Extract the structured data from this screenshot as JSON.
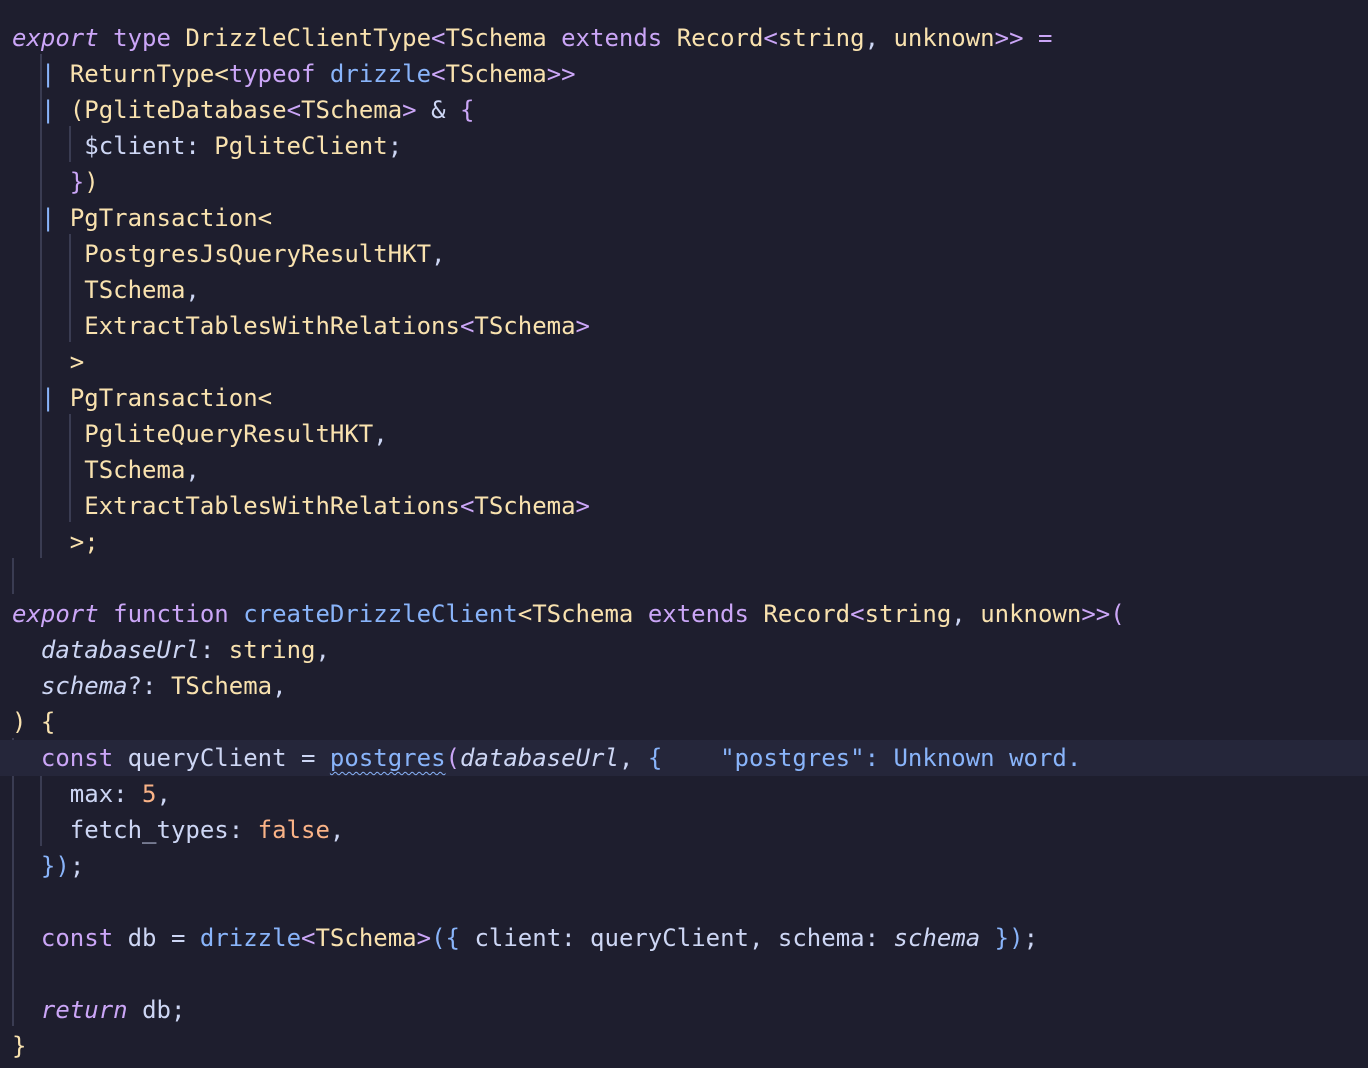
{
  "editor": {
    "language": "typescript",
    "theme_colors": {
      "background": "#1e1e2e",
      "keyword": "#cba6f7",
      "type": "#f9e2af",
      "function": "#89b4fa",
      "text": "#cdd6f4",
      "number": "#fab387",
      "current_line": "#25263a"
    },
    "diagnostic": {
      "word": "\"postgres\"",
      "message": ": Unknown word."
    },
    "tokens": {
      "export": "export",
      "type": "type",
      "DrizzleClientType": "DrizzleClientType",
      "lt": "<",
      "gt": ">",
      "TSchema": "TSchema",
      "extends": "extends",
      "Record": "Record",
      "string": "string",
      "comma_space": ", ",
      "unknown": "unknown",
      "close_generic_eq": ">> =",
      "pipe": "| ",
      "ReturnType": "ReturnType",
      "typeof": "typeof",
      "drizzle": "drizzle",
      "close2": ">>",
      "open_paren": "(",
      "PgliteDatabase": "PgliteDatabase",
      "amp": " & ",
      "open_brace": "{",
      "client_prop": "$client: ",
      "PgliteClient": "PgliteClient",
      "semi": ";",
      "close_brace": "}",
      "close_paren": ")",
      "PgTransaction": "PgTransaction",
      "PostgresJsQueryResultHKT": "PostgresJsQueryResultHKT",
      "comma": ",",
      "ExtractTablesWithRelations": "ExtractTablesWithRelations",
      "gt_semi": ">;",
      "function": "function",
      "createDrizzleClient": "createDrizzleClient",
      "close_generic_paren": ">>(",
      "databaseUrl": "databaseUrl",
      "colon_space": ": ",
      "schema": "schema",
      "optional_colon": "?: ",
      "close_sig": ") {",
      "const": "const",
      "queryClient": "queryClient",
      "eq": " = ",
      "postgres": "postgres",
      "max": "max: ",
      "five": "5",
      "fetch_types": "fetch_types: ",
      "false": "false",
      "close_obj_call": "})",
      "db": "db",
      "open_call_obj": "({ ",
      "client_key": "client: ",
      "schema_key": "schema: ",
      "close_call": " })",
      "return": "return",
      "db_semi": "db;"
    }
  }
}
